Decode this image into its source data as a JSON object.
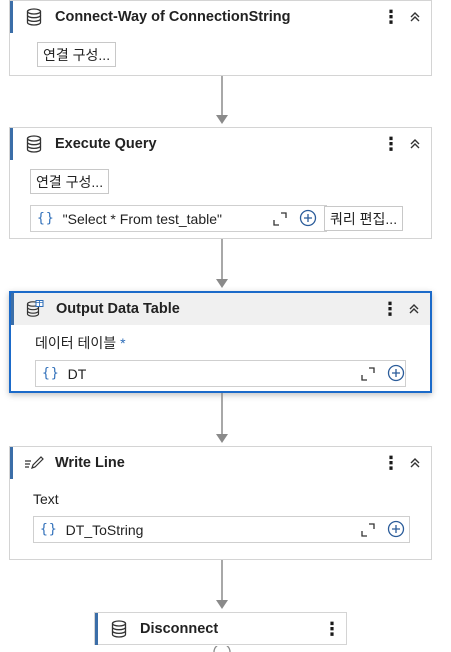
{
  "activities": [
    {
      "title": "Connect-Way of ConnectionString",
      "icon": "database-icon",
      "configure_label": "연결 구성..."
    },
    {
      "title": "Execute Query",
      "icon": "database-icon",
      "configure_label": "연결 구성...",
      "sql_value": "\"Select * From test_table\"",
      "edit_query_label": "쿼리 편집..."
    },
    {
      "title": "Output Data Table",
      "icon": "data-table-icon",
      "field_label": "데이터 테이블",
      "required_marker": "*",
      "value": "DT",
      "selected": true
    },
    {
      "title": "Write Line",
      "icon": "write-line-icon",
      "field_label": "Text",
      "value": "DT_ToString"
    },
    {
      "title": "Disconnect",
      "icon": "database-icon"
    }
  ],
  "icons": {
    "expression": "{}",
    "more": "⋮",
    "collapse": "chevron-double-up-icon"
  },
  "colors": {
    "accent": "#3b6ea8",
    "selection": "#1b6ac9",
    "connector": "#8a8a8a"
  }
}
